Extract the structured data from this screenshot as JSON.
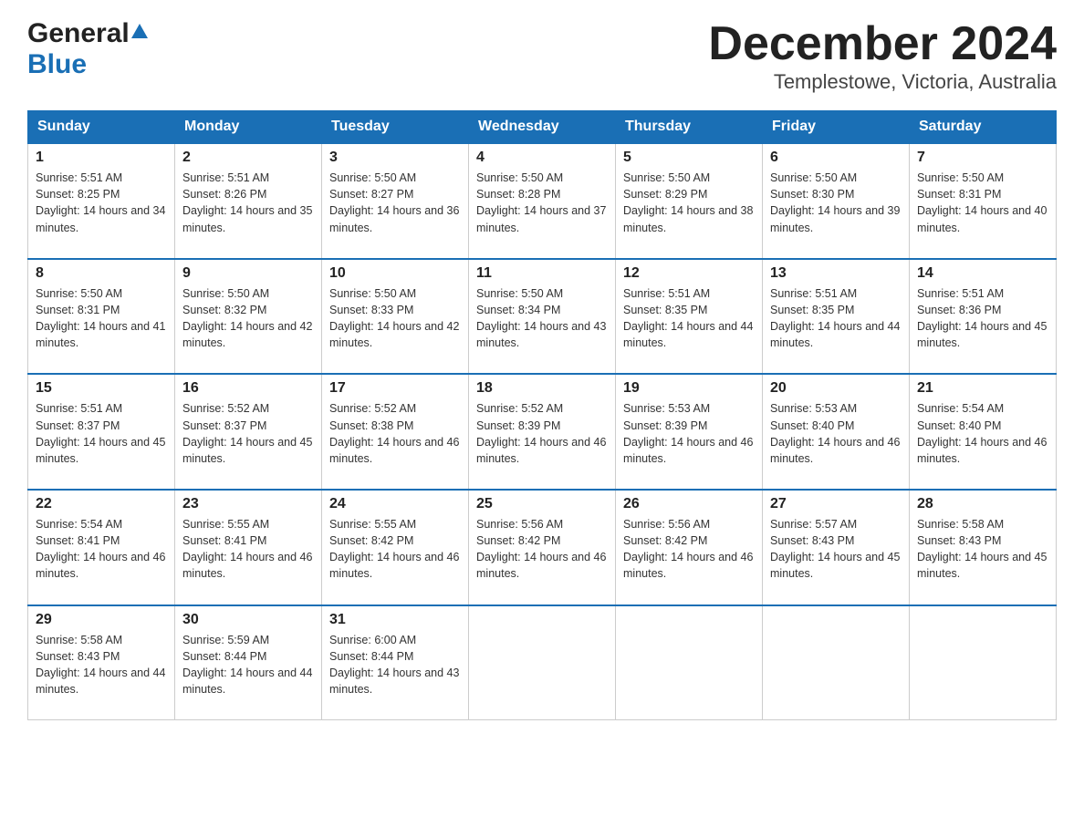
{
  "logo": {
    "general": "General",
    "blue": "Blue"
  },
  "title": "December 2024",
  "subtitle": "Templestowe, Victoria, Australia",
  "days_of_week": [
    "Sunday",
    "Monday",
    "Tuesday",
    "Wednesday",
    "Thursday",
    "Friday",
    "Saturday"
  ],
  "weeks": [
    [
      {
        "day": "1",
        "sunrise": "5:51 AM",
        "sunset": "8:25 PM",
        "daylight": "14 hours and 34 minutes."
      },
      {
        "day": "2",
        "sunrise": "5:51 AM",
        "sunset": "8:26 PM",
        "daylight": "14 hours and 35 minutes."
      },
      {
        "day": "3",
        "sunrise": "5:50 AM",
        "sunset": "8:27 PM",
        "daylight": "14 hours and 36 minutes."
      },
      {
        "day": "4",
        "sunrise": "5:50 AM",
        "sunset": "8:28 PM",
        "daylight": "14 hours and 37 minutes."
      },
      {
        "day": "5",
        "sunrise": "5:50 AM",
        "sunset": "8:29 PM",
        "daylight": "14 hours and 38 minutes."
      },
      {
        "day": "6",
        "sunrise": "5:50 AM",
        "sunset": "8:30 PM",
        "daylight": "14 hours and 39 minutes."
      },
      {
        "day": "7",
        "sunrise": "5:50 AM",
        "sunset": "8:31 PM",
        "daylight": "14 hours and 40 minutes."
      }
    ],
    [
      {
        "day": "8",
        "sunrise": "5:50 AM",
        "sunset": "8:31 PM",
        "daylight": "14 hours and 41 minutes."
      },
      {
        "day": "9",
        "sunrise": "5:50 AM",
        "sunset": "8:32 PM",
        "daylight": "14 hours and 42 minutes."
      },
      {
        "day": "10",
        "sunrise": "5:50 AM",
        "sunset": "8:33 PM",
        "daylight": "14 hours and 42 minutes."
      },
      {
        "day": "11",
        "sunrise": "5:50 AM",
        "sunset": "8:34 PM",
        "daylight": "14 hours and 43 minutes."
      },
      {
        "day": "12",
        "sunrise": "5:51 AM",
        "sunset": "8:35 PM",
        "daylight": "14 hours and 44 minutes."
      },
      {
        "day": "13",
        "sunrise": "5:51 AM",
        "sunset": "8:35 PM",
        "daylight": "14 hours and 44 minutes."
      },
      {
        "day": "14",
        "sunrise": "5:51 AM",
        "sunset": "8:36 PM",
        "daylight": "14 hours and 45 minutes."
      }
    ],
    [
      {
        "day": "15",
        "sunrise": "5:51 AM",
        "sunset": "8:37 PM",
        "daylight": "14 hours and 45 minutes."
      },
      {
        "day": "16",
        "sunrise": "5:52 AM",
        "sunset": "8:37 PM",
        "daylight": "14 hours and 45 minutes."
      },
      {
        "day": "17",
        "sunrise": "5:52 AM",
        "sunset": "8:38 PM",
        "daylight": "14 hours and 46 minutes."
      },
      {
        "day": "18",
        "sunrise": "5:52 AM",
        "sunset": "8:39 PM",
        "daylight": "14 hours and 46 minutes."
      },
      {
        "day": "19",
        "sunrise": "5:53 AM",
        "sunset": "8:39 PM",
        "daylight": "14 hours and 46 minutes."
      },
      {
        "day": "20",
        "sunrise": "5:53 AM",
        "sunset": "8:40 PM",
        "daylight": "14 hours and 46 minutes."
      },
      {
        "day": "21",
        "sunrise": "5:54 AM",
        "sunset": "8:40 PM",
        "daylight": "14 hours and 46 minutes."
      }
    ],
    [
      {
        "day": "22",
        "sunrise": "5:54 AM",
        "sunset": "8:41 PM",
        "daylight": "14 hours and 46 minutes."
      },
      {
        "day": "23",
        "sunrise": "5:55 AM",
        "sunset": "8:41 PM",
        "daylight": "14 hours and 46 minutes."
      },
      {
        "day": "24",
        "sunrise": "5:55 AM",
        "sunset": "8:42 PM",
        "daylight": "14 hours and 46 minutes."
      },
      {
        "day": "25",
        "sunrise": "5:56 AM",
        "sunset": "8:42 PM",
        "daylight": "14 hours and 46 minutes."
      },
      {
        "day": "26",
        "sunrise": "5:56 AM",
        "sunset": "8:42 PM",
        "daylight": "14 hours and 46 minutes."
      },
      {
        "day": "27",
        "sunrise": "5:57 AM",
        "sunset": "8:43 PM",
        "daylight": "14 hours and 45 minutes."
      },
      {
        "day": "28",
        "sunrise": "5:58 AM",
        "sunset": "8:43 PM",
        "daylight": "14 hours and 45 minutes."
      }
    ],
    [
      {
        "day": "29",
        "sunrise": "5:58 AM",
        "sunset": "8:43 PM",
        "daylight": "14 hours and 44 minutes."
      },
      {
        "day": "30",
        "sunrise": "5:59 AM",
        "sunset": "8:44 PM",
        "daylight": "14 hours and 44 minutes."
      },
      {
        "day": "31",
        "sunrise": "6:00 AM",
        "sunset": "8:44 PM",
        "daylight": "14 hours and 43 minutes."
      },
      null,
      null,
      null,
      null
    ]
  ],
  "labels": {
    "sunrise": "Sunrise:",
    "sunset": "Sunset:",
    "daylight": "Daylight:"
  }
}
